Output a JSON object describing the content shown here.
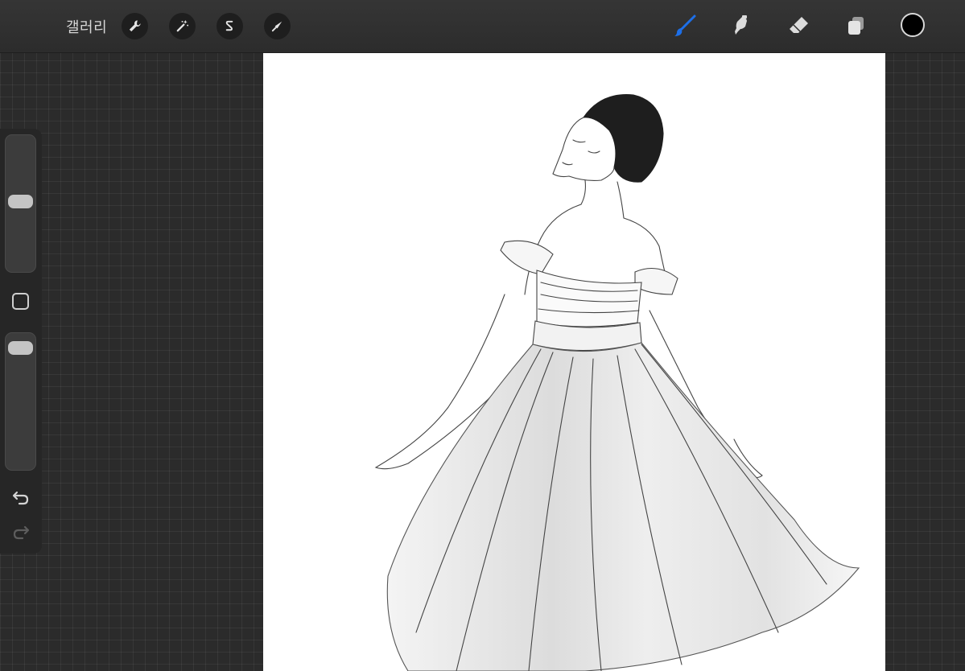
{
  "topbar": {
    "gallery_label": "갤러리",
    "left_tools": [
      "wrench-icon",
      "magic-wand-icon",
      "selection-icon",
      "transform-arrow-icon"
    ],
    "right_tools": [
      "brush-icon",
      "smudge-icon",
      "eraser-icon",
      "layers-icon"
    ],
    "active_tool": "brush",
    "active_color": "#1d6fe8",
    "current_color": "#000000"
  },
  "sidebar": {
    "brush_size_level": 0.52,
    "opacity_level": 0.95,
    "icons": [
      "modify-square-icon",
      "undo-icon",
      "redo-icon"
    ]
  }
}
